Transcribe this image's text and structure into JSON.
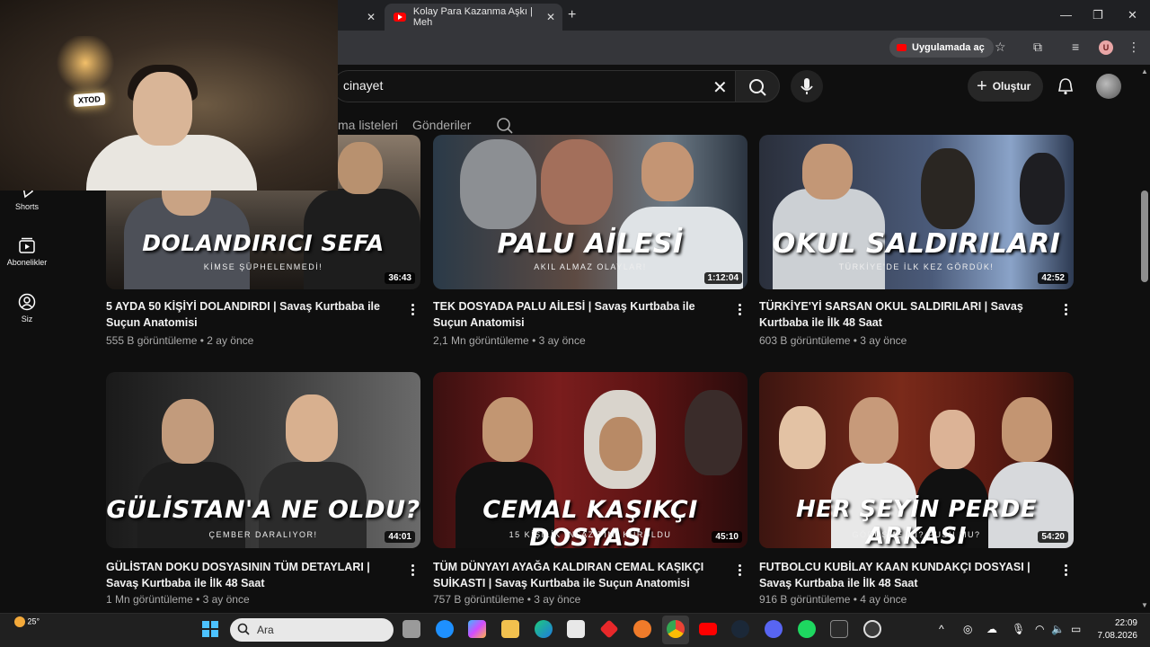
{
  "browser": {
    "tabs": [
      {
        "label": ""
      },
      {
        "label": "Kolay Para Kazanma Aşkı | Meh"
      }
    ],
    "open_in_app_label": "Uygulamada aç",
    "profile_initial": "U"
  },
  "youtube": {
    "search": {
      "query": "cinayet"
    },
    "create_label": "Oluştur",
    "channel_tabs": [
      "ma listeleri",
      "Gönderiler"
    ],
    "guide": [
      {
        "label": "Shorts",
        "icon": "shorts-icon"
      },
      {
        "label": "Abonelikler",
        "icon": "subscriptions-icon"
      },
      {
        "label": "Siz",
        "icon": "you-icon"
      }
    ],
    "videos": [
      {
        "title": "5 AYDA 50 KİŞİYİ DOLANDIRDI | Savaş Kurtbaba ile Suçun Anatomisi",
        "views": "555 B görüntüleme",
        "age": "2 ay önce",
        "duration": "36:43",
        "thumb_title": "DOLANDIRICI SEFA",
        "thumb_sub": "KİMSE ŞÜPHELENMEDİ!"
      },
      {
        "title": "TEK DOSYADA PALU AİLESİ | Savaş Kurtbaba ile Suçun Anatomisi",
        "views": "2,1 Mn görüntüleme",
        "age": "3 ay önce",
        "duration": "1:12:04",
        "thumb_title": "PALU AİLESİ",
        "thumb_sub": "AKIL ALMAZ OLAYLAR!"
      },
      {
        "title": "TÜRKİYE'Yİ SARSAN OKUL SALDIRILARI | Savaş Kurtbaba ile İlk 48 Saat",
        "views": "603 B görüntüleme",
        "age": "3 ay önce",
        "duration": "42:52",
        "thumb_title": "OKUL SALDIRILARI",
        "thumb_sub": "TÜRKİYE'DE İLK KEZ GÖRDÜK!"
      },
      {
        "title": "GÜLİSTAN DOKU DOSYASININ TÜM DETAYLARI | Savaş Kurtbaba ile İlk 48 Saat",
        "views": "1 Mn görüntüleme",
        "age": "3 ay önce",
        "duration": "44:01",
        "thumb_title": "GÜLİSTAN'A NE OLDU?",
        "thumb_sub": "ÇEMBER DARALIYOR!"
      },
      {
        "title": "TÜM DÜNYAYI AYAĞA KALDIRAN CEMAL KAŞIKÇI SUİKASTI | Savaş Kurtbaba ile Suçun Anatomisi",
        "views": "757 B görüntüleme",
        "age": "3 ay önce",
        "duration": "45:10",
        "thumb_title": "CEMAL KAŞIKÇI DOSYASI",
        "thumb_sub": "15 KİŞİLİK İNFAZ TİMİ KURULDU"
      },
      {
        "title": "FUTBOLCU KUBİLAY KAAN KUNDAKÇI DOSYASI | Savaş Kurtbaba ile İlk 48 Saat",
        "views": "916 B görüntüleme",
        "age": "4 ay önce",
        "duration": "54:20",
        "thumb_title": "HER ŞEYİN PERDE ARKASI",
        "thumb_sub": "GÖRÜŞME Mİ? PUSU MU?"
      }
    ]
  },
  "webcam": {
    "badge": "XTOD"
  },
  "taskbar": {
    "weather": "25°",
    "search_placeholder": "Ara",
    "time": "22:09",
    "date": "7.08.2026"
  },
  "colors": {
    "youtube_red": "#ff0000",
    "background": "#0f0f0f"
  }
}
